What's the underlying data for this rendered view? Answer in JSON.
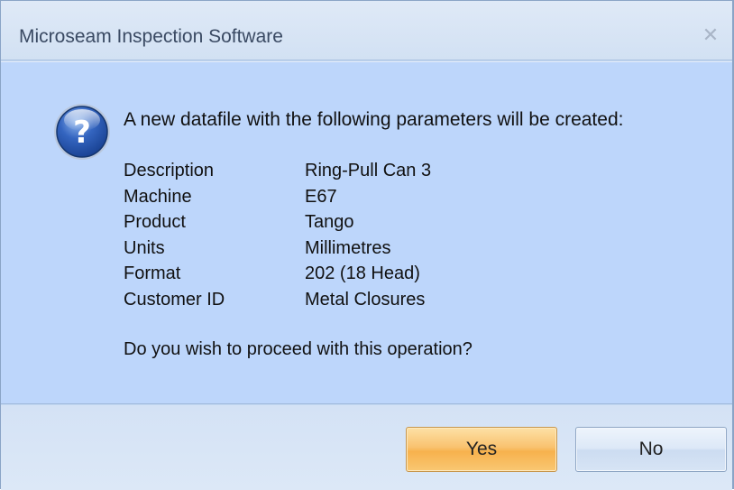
{
  "window": {
    "title": "Microseam Inspection Software",
    "close_symbol": "✕"
  },
  "message": {
    "icon": "question-icon",
    "heading": "A new datafile with the following parameters will be created:",
    "params": [
      {
        "label": "Description",
        "value": "Ring-Pull Can 3"
      },
      {
        "label": "Machine",
        "value": "E67"
      },
      {
        "label": "Product",
        "value": "Tango"
      },
      {
        "label": "Units",
        "value": "Millimetres"
      },
      {
        "label": "Format",
        "value": "202 (18 Head)"
      },
      {
        "label": "Customer ID",
        "value": "Metal Closures"
      }
    ],
    "prompt": "Do you wish to proceed with this operation?"
  },
  "buttons": {
    "yes_label": "Yes",
    "no_label": "No"
  },
  "colors": {
    "content_bg": "#bdd6fb",
    "yes_accent": "#f9c26f",
    "icon_blue": "#1e4fa8"
  }
}
